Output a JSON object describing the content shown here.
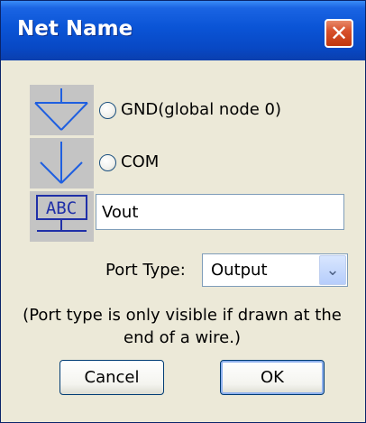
{
  "window": {
    "title": "Net Name",
    "close_label": "✕"
  },
  "options": {
    "gnd_label": "GND(global node 0)",
    "com_label": "COM",
    "abc_symbol_text": "ABC",
    "gnd_icon": "ground-symbol-icon",
    "com_icon": "com-arrow-icon",
    "label_icon": "net-label-icon"
  },
  "net_name": {
    "value": "Vout"
  },
  "port_type": {
    "label": "Port Type:",
    "selected": "Output"
  },
  "note": "(Port type is only visible if drawn at the end of a wire.)",
  "buttons": {
    "cancel": "Cancel",
    "ok": "OK"
  },
  "colors": {
    "titlebar": "#0a54d6",
    "symbol_stroke": "#1f5fe0",
    "dialog_bg": "#ece9d8"
  }
}
